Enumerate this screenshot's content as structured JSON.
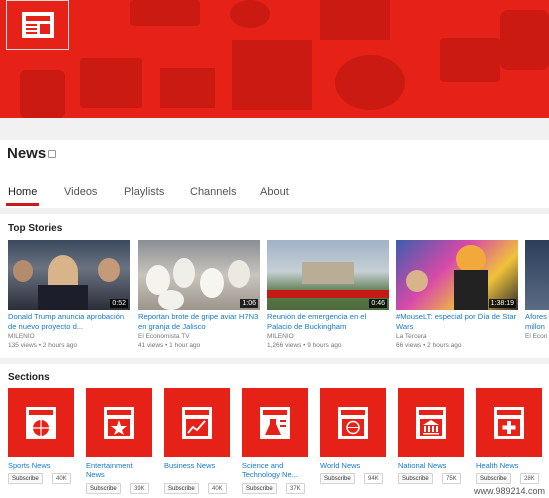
{
  "channel": {
    "title": "News"
  },
  "tabs": [
    {
      "label": "Home"
    },
    {
      "label": "Videos"
    },
    {
      "label": "Playlists"
    },
    {
      "label": "Channels"
    },
    {
      "label": "About"
    }
  ],
  "top_stories": {
    "title": "Top Stories",
    "videos": [
      {
        "title": "Donald Trump anuncia aprobación de nuevo proyecto d...",
        "channel": "MILENIO",
        "meta": "135 views • 2 hours ago",
        "duration": "0:52"
      },
      {
        "title": "Reportan brote de gripe aviar H7N3 en granja de Jalisco",
        "channel": "El Economista TV",
        "meta": "41 views • 1 hour ago",
        "duration": "1:06"
      },
      {
        "title": "Reunión de emergencia en el Palacio de Buckingham",
        "channel": "MILENIO",
        "meta": "1,266 views • 9 hours ago",
        "duration": "0:46"
      },
      {
        "title": "#MouseLT: especial por Día de Star Wars",
        "channel": "La Tercera",
        "meta": "66 views • 2 hours ago",
        "duration": "1:38:19"
      },
      {
        "title": "Afores millon",
        "channel": "El Econ",
        "meta": "",
        "duration": ""
      }
    ]
  },
  "sections": {
    "title": "Sections",
    "items": [
      {
        "label": "Sports News",
        "subscribe": "Subscribe",
        "count": "40K",
        "icon": "basketball-icon"
      },
      {
        "label": "Entertainment News",
        "subscribe": "Subscribe",
        "count": "39K",
        "icon": "star-icon"
      },
      {
        "label": "Business News",
        "subscribe": "Subscribe",
        "count": "40K",
        "icon": "chart-icon"
      },
      {
        "label": "Science and Technology Ne...",
        "subscribe": "Subscribe",
        "count": "37K",
        "icon": "flask-icon"
      },
      {
        "label": "World News",
        "subscribe": "Subscribe",
        "count": "94K",
        "icon": "globe-icon"
      },
      {
        "label": "National News",
        "subscribe": "Subscribe",
        "count": "75K",
        "icon": "building-icon"
      },
      {
        "label": "Health News",
        "subscribe": "Subscribe",
        "count": "28K",
        "icon": "medical-cross-icon"
      }
    ]
  },
  "watermark": "www.989214.com",
  "colors": {
    "brand_red": "#e62117",
    "link_blue": "#167ac6",
    "active_tab": "#cc181e"
  }
}
